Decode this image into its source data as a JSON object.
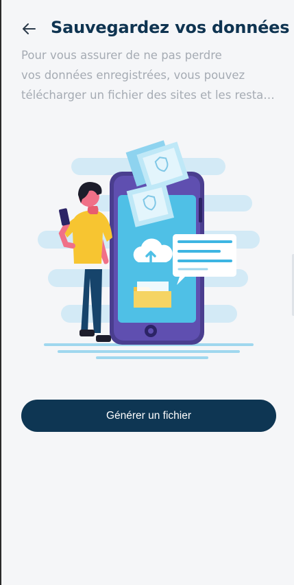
{
  "header": {
    "back_icon": "arrow-left-icon",
    "title": "Sauvegardez vos données"
  },
  "description": {
    "line1": "Pour vous assurer de ne pas perdre",
    "line2": "vos données enregistrées, vous pouvez",
    "line3": "télécharger un fichier des sites et les restaure..."
  },
  "illustration": {
    "icon": "phone-backup-illustration"
  },
  "actions": {
    "generate_label": "Générer un fichier"
  },
  "colors": {
    "primary": "#0e3653",
    "title": "#0f3451",
    "text_muted": "#a5abb3",
    "background": "#f5f6f8"
  }
}
